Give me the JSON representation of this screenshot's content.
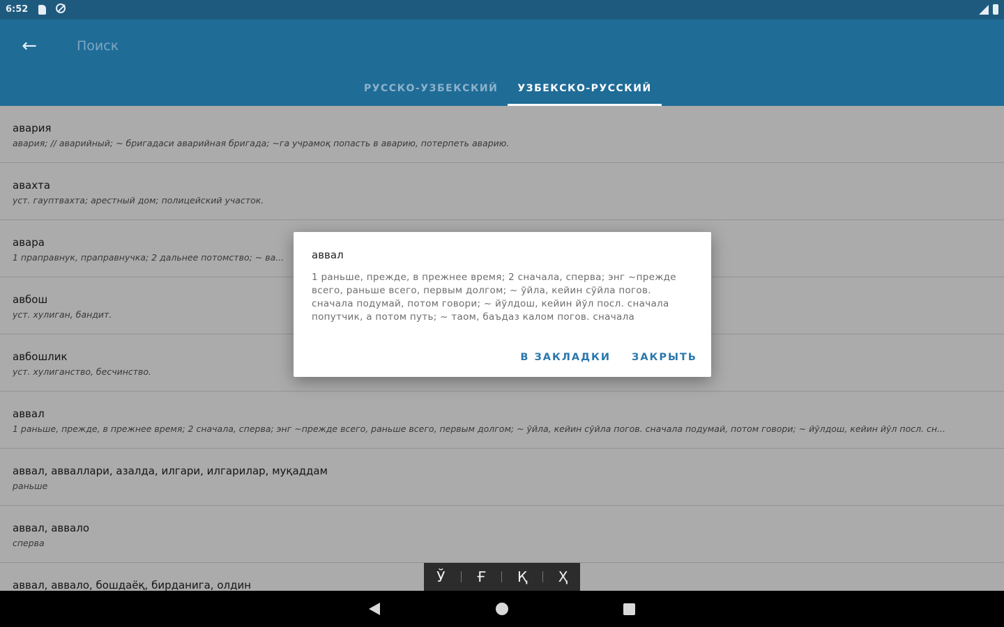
{
  "status_bar": {
    "time": "6:52"
  },
  "search": {
    "placeholder": "Поиск"
  },
  "tabs": [
    {
      "label": "РУССКО-УЗБЕКСКИЙ",
      "active": false
    },
    {
      "label": "УЗБЕКСКО-РУССКИЙ",
      "active": true
    }
  ],
  "entries": [
    {
      "word": "авария",
      "definition": "авария; // аварийный; ~ бригадаси аварийная бригада; ~га учрамоқ попасть в аварию, потерпеть аварию."
    },
    {
      "word": "авахта",
      "definition": "уст. гауптвахта; арестный дом; полицейский участок."
    },
    {
      "word": "авара",
      "definition": "1 праправнук, праправнучка; 2 дальнее потомство; ~ ва..."
    },
    {
      "word": "авбош",
      "definition": "уст. хулиган, бандит."
    },
    {
      "word": "авбошлик",
      "definition": "уст. хулиганство, бесчинство."
    },
    {
      "word": "аввал",
      "definition": "1 раньше, прежде, в прежнее время; 2 сначала, сперва; энг ~прежде всего, раньше всего, первым долгом; ~ ўйла, кейин сўйла погов. сначала подумай, потом говори; ~ йўлдош, кейин йўл посл. сн..."
    },
    {
      "word": "аввал, авваллари, азалда, илгари, илгарилар, муқаддам",
      "definition": "раньше"
    },
    {
      "word": "аввал, аввало",
      "definition": "сперва"
    },
    {
      "word": "аввал, аввало, бошдаёқ, бирданига, олдин",
      "definition": ""
    }
  ],
  "dialog": {
    "title": "аввал",
    "body": "1 раньше, прежде, в прежнее время; 2 сначала, сперва; энг ~прежде всего, раньше всего, первым долгом; ~ ўйла, кейин сўйла погов. сначала подумай, потом говори; ~ йўлдош, кейин йўл посл. сначала попутчик, а потом путь; ~ таом, баъдаз калом погов. сначала",
    "bookmark_label": "В ЗАКЛАДКИ",
    "close_label": "ЗАКРЫТЬ"
  },
  "special_chars": [
    "Ў",
    "Ғ",
    "Қ",
    "Ҳ"
  ],
  "colors": {
    "app_bar": "#1f6c97",
    "status_bar": "#1d5a7e",
    "accent": "#2a77ad"
  }
}
